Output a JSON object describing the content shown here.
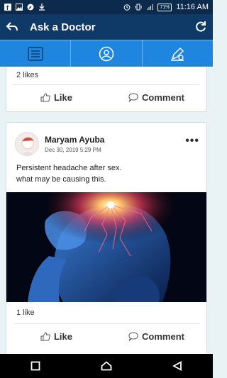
{
  "status_bar": {
    "battery": "71%",
    "time": "11:16 AM"
  },
  "app_bar": {
    "title": "Ask a Doctor",
    "back_icon": "back-icon",
    "refresh_icon": "refresh-icon"
  },
  "tabs": [
    {
      "icon": "list-icon"
    },
    {
      "icon": "doctor-icon"
    },
    {
      "icon": "edit-icon"
    }
  ],
  "posts": [
    {
      "likes": "2 likes",
      "like_label": "Like",
      "comment_label": "Comment"
    },
    {
      "author": "Maryam Ayuba",
      "date": "Dec 30, 2019 5:29 PM",
      "more": "•••",
      "text_line1": "Persistent headache after sex.",
      "text_line2": "what may be causing this.",
      "likes": "1 like",
      "like_label": "Like",
      "comment_label": "Comment"
    }
  ],
  "colors": {
    "status_bar": "#0b2a4c",
    "app_bar": "#0f3a68",
    "tab_bar": "#1f86e0",
    "background": "#e9f3f6"
  }
}
